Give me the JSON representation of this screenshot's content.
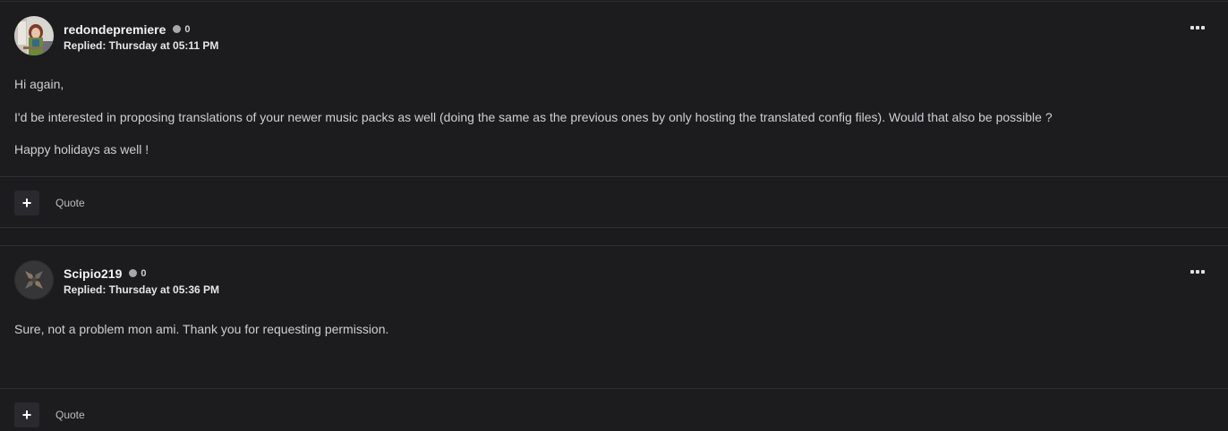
{
  "posts": [
    {
      "username": "redondepremiere",
      "reputation": "0",
      "replied": "Replied: Thursday at 05:11 PM",
      "paragraphs": [
        "Hi again,",
        "I'd be interested in proposing translations of your newer music packs as well (doing the same as the previous ones by only hosting the translated config files). Would that also be possible ?",
        "Happy holidays as well !"
      ],
      "add_label": "+",
      "quote_label": "Quote",
      "menu_icon": "ellipsis-icon"
    },
    {
      "username": "Scipio219",
      "reputation": "0",
      "replied": "Replied: Thursday at 05:36 PM",
      "paragraphs": [
        "Sure, not a problem mon ami. Thank you for requesting permission."
      ],
      "add_label": "+",
      "quote_label": "Quote",
      "menu_icon": "ellipsis-icon"
    }
  ],
  "colors": {
    "background": "#1c1c1f",
    "divider": "#2e2e32",
    "text": "#cfcfd2",
    "username": "#f2f2f3",
    "status_dot": "#a8a8ac"
  }
}
